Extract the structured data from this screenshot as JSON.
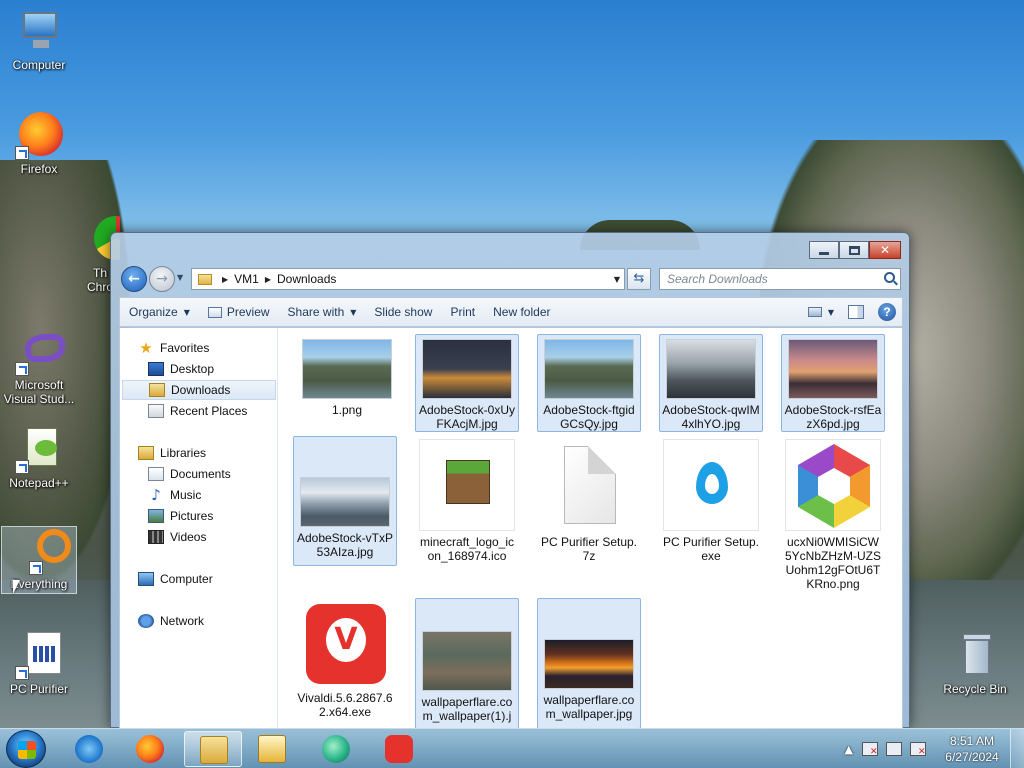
{
  "desktop": {
    "icons": [
      {
        "label": "Computer",
        "icon": "computer-icon"
      },
      {
        "label": "Firefox",
        "icon": "firefox-icon"
      },
      {
        "label": "Th\nChro",
        "icon": "chrome-partial-icon"
      },
      {
        "label": "Microsoft Visual Stud...",
        "icon": "visual-studio-icon"
      },
      {
        "label": "Notepad++",
        "icon": "notepadpp-icon"
      },
      {
        "label": "Everything",
        "icon": "everything-icon"
      },
      {
        "label": "PC Purifier",
        "icon": "pc-purifier-icon"
      },
      {
        "label": "Recycle Bin",
        "icon": "recycle-bin-icon"
      }
    ]
  },
  "window": {
    "breadcrumb": [
      "VM1",
      "Downloads"
    ],
    "search_placeholder": "Search Downloads",
    "toolbar": {
      "organize": "Organize",
      "preview": "Preview",
      "share_with": "Share with",
      "slide_show": "Slide show",
      "print": "Print",
      "new_folder": "New folder"
    },
    "nav": {
      "favorites": "Favorites",
      "desktop": "Desktop",
      "downloads": "Downloads",
      "recent_places": "Recent Places",
      "libraries": "Libraries",
      "documents": "Documents",
      "music": "Music",
      "pictures": "Pictures",
      "videos": "Videos",
      "computer": "Computer",
      "network": "Network"
    },
    "files": [
      {
        "name": "1.png",
        "selected": false,
        "kind": "bay"
      },
      {
        "name": "AdobeStock-0xUyFKAcjM.jpg",
        "selected": true,
        "kind": "city"
      },
      {
        "name": "AdobeStock-ftgidGCsQy.jpg",
        "selected": true,
        "kind": "bay"
      },
      {
        "name": "AdobeStock-qwIM4xlhYO.jpg",
        "selected": true,
        "kind": "mount"
      },
      {
        "name": "AdobeStock-rsfEazX6pd.jpg",
        "selected": true,
        "kind": "sunset"
      },
      {
        "name": "AdobeStock-vTxP53AIza.jpg",
        "selected": true,
        "kind": "aerial"
      },
      {
        "name": "minecraft_logo_icon_168974.ico",
        "selected": false,
        "kind": "cube"
      },
      {
        "name": "PC Purifier Setup.7z",
        "selected": false,
        "kind": "blank"
      },
      {
        "name": "PC Purifier Setup.exe",
        "selected": false,
        "kind": "drop"
      },
      {
        "name": "ucxNi0WMISiCW5YcNbZHzM-UZSUohm12gFOtU6TKRno.png",
        "selected": false,
        "kind": "hex"
      },
      {
        "name": "Vivaldi.5.6.2867.62.x64.exe",
        "selected": false,
        "kind": "vivaldi"
      },
      {
        "name": "wallpaperflare.com_wallpaper(1).j",
        "selected": true,
        "kind": "forest"
      },
      {
        "name": "wallpaperflare.com_wallpaper.jpg",
        "selected": true,
        "kind": "fire"
      }
    ]
  },
  "taskbar": {
    "apps": [
      "internet-explorer",
      "firefox",
      "windows-explorer",
      "media-player",
      "pc-purifier",
      "vivaldi"
    ],
    "time": "8:51 AM",
    "date": "6/27/2024"
  }
}
